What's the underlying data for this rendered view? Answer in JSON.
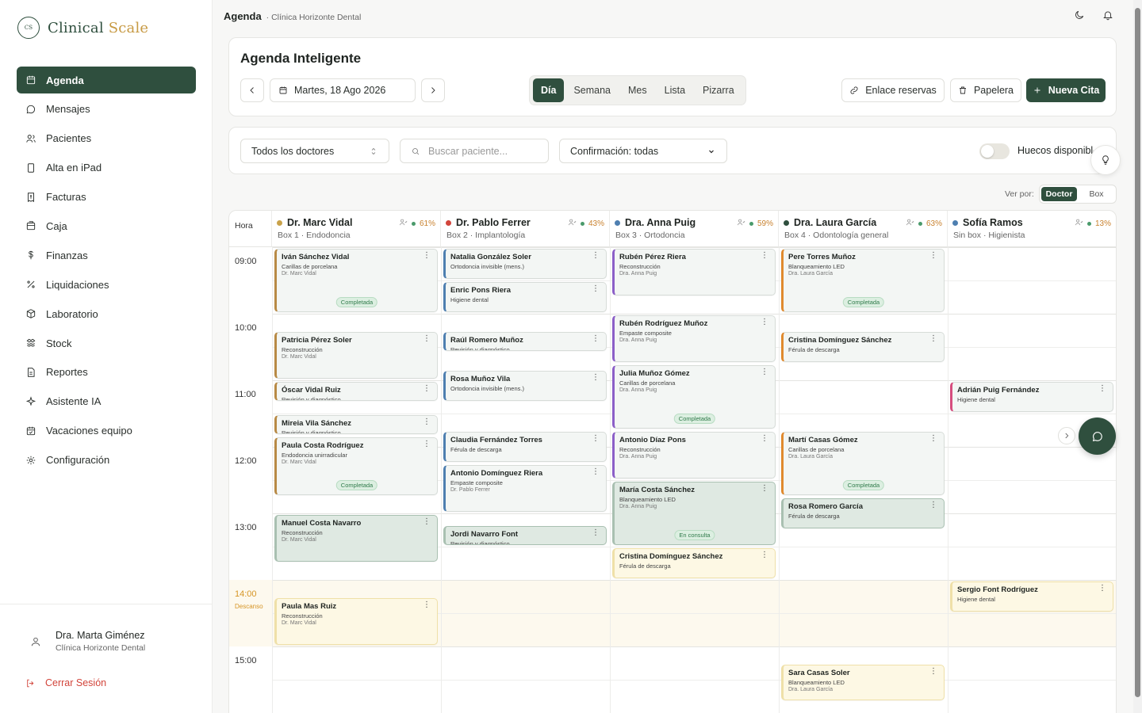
{
  "app": {
    "name_part1": "Clinical",
    "name_part2": "Scale",
    "logo_mark": "CS"
  },
  "nav": [
    {
      "label": "Agenda",
      "icon": "calendar-icon",
      "active": true
    },
    {
      "label": "Mensajes",
      "icon": "chat-icon"
    },
    {
      "label": "Pacientes",
      "icon": "users-icon"
    },
    {
      "label": "Alta en iPad",
      "icon": "tablet-icon"
    },
    {
      "label": "Facturas",
      "icon": "invoice-icon"
    },
    {
      "label": "Caja",
      "icon": "cashbox-icon"
    },
    {
      "label": "Finanzas",
      "icon": "dollar-icon"
    },
    {
      "label": "Liquidaciones",
      "icon": "percent-icon"
    },
    {
      "label": "Laboratorio",
      "icon": "box-icon"
    },
    {
      "label": "Stock",
      "icon": "stock-icon"
    },
    {
      "label": "Reportes",
      "icon": "report-icon"
    },
    {
      "label": "Asistente IA",
      "icon": "sparkle-icon"
    },
    {
      "label": "Vacaciones equipo",
      "icon": "calendar-check-icon"
    },
    {
      "label": "Configuración",
      "icon": "gear-icon"
    }
  ],
  "user": {
    "name": "Dra. Marta Giménez",
    "clinic": "Clínica Horizonte Dental",
    "logout": "Cerrar Sesión"
  },
  "topbar": {
    "crumb": "Agenda",
    "sub": "· Clínica Horizonte Dental"
  },
  "header": {
    "title": "Agenda Inteligente",
    "date": "Martes, 18 Ago 2026",
    "views": [
      "Día",
      "Semana",
      "Mes",
      "Lista",
      "Pizarra"
    ],
    "active_view": "Día",
    "link_btn": "Enlace reservas",
    "trash_btn": "Papelera",
    "new_btn": "Nueva Cita"
  },
  "filters": {
    "doctors": "Todos los doctores",
    "search_placeholder": "Buscar paciente...",
    "confirmation": "Confirmación: todas",
    "slots_label": "Huecos disponibles"
  },
  "viewby": {
    "label": "Ver por:",
    "options": [
      "Doctor",
      "Box"
    ],
    "active": "Doctor"
  },
  "calendar": {
    "hora_label": "Hora",
    "hours": [
      "09:00",
      "10:00",
      "11:00",
      "12:00",
      "13:00",
      "14:00",
      "15:00"
    ],
    "break_label": "Descanso",
    "doctors": [
      {
        "name": "Dr. Marc Vidal",
        "box": "Box 1 · Endodoncia",
        "occupancy": "61%",
        "dot": "#c9a24a"
      },
      {
        "name": "Dr. Pablo Ferrer",
        "box": "Box 2 · Implantología",
        "occupancy": "43%",
        "dot": "#d2453b"
      },
      {
        "name": "Dra. Anna Puig",
        "box": "Box 3 · Ortodoncia",
        "occupancy": "59%",
        "dot": "#4e7fb0"
      },
      {
        "name": "Dra. Laura García",
        "box": "Box 4 · Odontología general",
        "occupancy": "63%",
        "dot": "#2f4f3e"
      },
      {
        "name": "Sofía Ramos",
        "box": "Sin box · Higienista",
        "occupancy": "13%",
        "dot": "#4e7fb0"
      }
    ],
    "appointments": [
      {
        "col": 0,
        "start": "09:00",
        "end": "10:00",
        "name": "Iván Sánchez Vidal",
        "treatment": "Carillas de porcelana",
        "doctor": "Dr. Marc Vidal",
        "color": "brown",
        "status": "green",
        "badge": "Completada"
      },
      {
        "col": 0,
        "start": "10:15",
        "end": "11:00",
        "name": "Patricia Pérez Soler",
        "treatment": "Reconstrucción",
        "doctor": "Dr. Marc Vidal",
        "color": "brown",
        "status": "green"
      },
      {
        "col": 0,
        "start": "11:00",
        "end": "11:20",
        "name": "Óscar Vidal Ruiz",
        "treatment": "Revisión y diagnóstico",
        "doctor": "",
        "color": "brown",
        "status": "green"
      },
      {
        "col": 0,
        "start": "11:30",
        "end": "11:50",
        "name": "Mireia Vila Sánchez",
        "treatment": "Revisión y diagnóstico",
        "doctor": "",
        "color": "brown",
        "status": "green"
      },
      {
        "col": 0,
        "start": "11:50",
        "end": "12:45",
        "name": "Paula Costa Rodríguez",
        "treatment": "Endodoncia unirradicular",
        "doctor": "Dr. Marc Vidal",
        "color": "brown",
        "status": "green",
        "badge": "Completada"
      },
      {
        "col": 0,
        "start": "13:00",
        "end": "13:45",
        "name": "Manuel Costa Navarro",
        "treatment": "Reconstrucción",
        "doctor": "Dr. Marc Vidal",
        "color": "brown",
        "status": "greenstrong"
      },
      {
        "col": 0,
        "start": "14:15",
        "end": "15:00",
        "name": "Paula Mas Ruiz",
        "treatment": "Reconstrucción",
        "doctor": "Dr. Marc Vidal",
        "color": "brown",
        "status": "yellow"
      },
      {
        "col": 1,
        "start": "09:00",
        "end": "09:30",
        "name": "Natalia González Soler",
        "treatment": "Ortodoncia invisible (mens.)",
        "doctor": "",
        "color": "blue",
        "status": "green"
      },
      {
        "col": 1,
        "start": "09:30",
        "end": "10:00",
        "name": "Enric Pons Riera",
        "treatment": "Higiene dental",
        "doctor": "",
        "color": "blue",
        "status": "green"
      },
      {
        "col": 1,
        "start": "10:15",
        "end": "10:35",
        "name": "Raúl Romero Muñoz",
        "treatment": "Revisión y diagnóstico",
        "doctor": "",
        "color": "blue",
        "status": "green"
      },
      {
        "col": 1,
        "start": "10:50",
        "end": "11:20",
        "name": "Rosa Muñoz Vila",
        "treatment": "Ortodoncia invisible (mens.)",
        "doctor": "",
        "color": "blue",
        "status": "green"
      },
      {
        "col": 1,
        "start": "11:45",
        "end": "12:15",
        "name": "Claudia Fernández Torres",
        "treatment": "Férula de descarga",
        "doctor": "",
        "color": "blue",
        "status": "green"
      },
      {
        "col": 1,
        "start": "12:15",
        "end": "13:00",
        "name": "Antonio Domínguez Riera",
        "treatment": "Empaste composite",
        "doctor": "Dr. Pablo Ferrer",
        "color": "blue",
        "status": "green"
      },
      {
        "col": 1,
        "start": "13:10",
        "end": "13:30",
        "name": "Jordi Navarro Font",
        "treatment": "Revisión y diagnóstico",
        "doctor": "",
        "color": "blue",
        "status": "greenstrong"
      },
      {
        "col": 2,
        "start": "09:00",
        "end": "09:45",
        "name": "Rubén Pérez Riera",
        "treatment": "Reconstrucción",
        "doctor": "Dra. Anna Puig",
        "color": "purple",
        "status": "green"
      },
      {
        "col": 2,
        "start": "10:00",
        "end": "10:45",
        "name": "Rubén Rodríguez Muñoz",
        "treatment": "Empaste composite",
        "doctor": "Dra. Anna Puig",
        "color": "purple",
        "status": "green"
      },
      {
        "col": 2,
        "start": "10:45",
        "end": "11:45",
        "name": "Julia Muñoz Gómez",
        "treatment": "Carillas de porcelana",
        "doctor": "Dra. Anna Puig",
        "color": "purple",
        "status": "green",
        "badge": "Completada"
      },
      {
        "col": 2,
        "start": "11:45",
        "end": "12:30",
        "name": "Antonio Díaz Pons",
        "treatment": "Reconstrucción",
        "doctor": "Dra. Anna Puig",
        "color": "purple",
        "status": "green"
      },
      {
        "col": 2,
        "start": "12:30",
        "end": "13:30",
        "name": "María Costa Sánchez",
        "treatment": "Blanqueamiento LED",
        "doctor": "Dra. Anna Puig",
        "color": "purple",
        "status": "greenstrong",
        "badge": "En consulta"
      },
      {
        "col": 2,
        "start": "13:30",
        "end": "14:00",
        "name": "Cristina Domínguez Sánchez",
        "treatment": "Férula de descarga",
        "doctor": "",
        "color": "purple",
        "status": "yellow"
      },
      {
        "col": 3,
        "start": "09:00",
        "end": "10:00",
        "name": "Pere Torres Muñoz",
        "treatment": "Blanqueamiento LED",
        "doctor": "Dra. Laura García",
        "color": "orange",
        "status": "green",
        "badge": "Completada"
      },
      {
        "col": 3,
        "start": "10:15",
        "end": "10:45",
        "name": "Cristina Domínguez Sánchez",
        "treatment": "Férula de descarga",
        "doctor": "",
        "color": "orange",
        "status": "green"
      },
      {
        "col": 3,
        "start": "11:45",
        "end": "12:45",
        "name": "Martí Casas Gómez",
        "treatment": "Carillas de porcelana",
        "doctor": "Dra. Laura García",
        "color": "orange",
        "status": "green",
        "badge": "Completada"
      },
      {
        "col": 3,
        "start": "12:45",
        "end": "13:15",
        "name": "Rosa Romero García",
        "treatment": "Férula de descarga",
        "doctor": "",
        "color": "orange",
        "status": "greenstrong"
      },
      {
        "col": 3,
        "start": "15:15",
        "end": "15:50",
        "name": "Sara Casas Soler",
        "treatment": "Blanqueamiento LED",
        "doctor": "Dra. Laura García",
        "color": "orange",
        "status": "yellow"
      },
      {
        "col": 4,
        "start": "11:00",
        "end": "11:30",
        "name": "Adrián Puig Fernández",
        "treatment": "Higiene dental",
        "doctor": "",
        "color": "pink",
        "status": "green"
      },
      {
        "col": 4,
        "start": "14:00",
        "end": "14:30",
        "name": "Sergio Font Rodríguez",
        "treatment": "Higiene dental",
        "doctor": "",
        "color": "pink",
        "status": "yellow"
      }
    ]
  }
}
